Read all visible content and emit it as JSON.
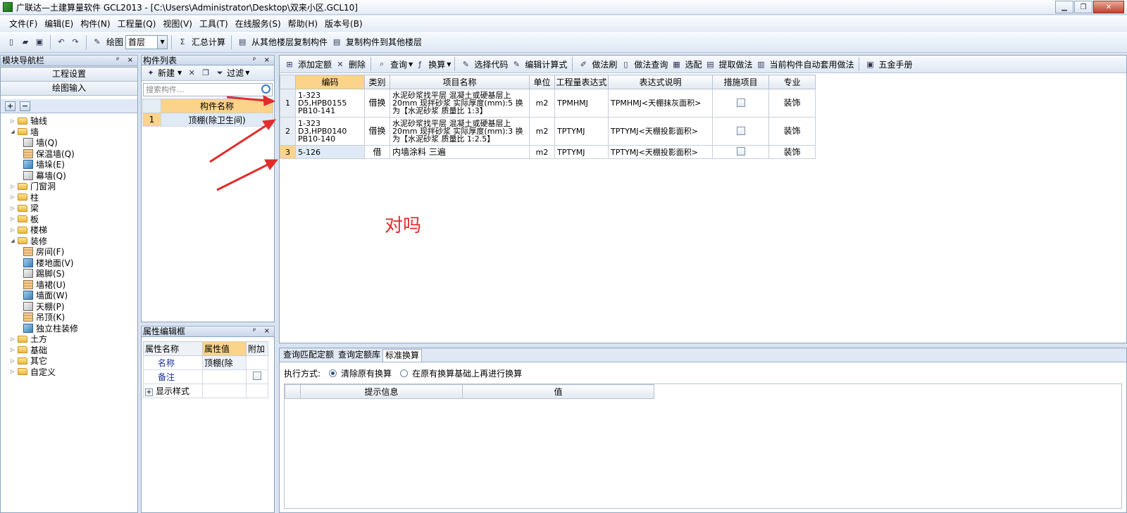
{
  "window": {
    "title": "广联达—土建算量软件 GCL2013 - [C:\\Users\\Administrator\\Desktop\\双来小区.GCL10]",
    "min": "▁",
    "max": "❐",
    "close": "✕"
  },
  "menu": [
    "文件(F)",
    "编辑(E)",
    "构件(N)",
    "工程量(Q)",
    "视图(V)",
    "工具(T)",
    "在线服务(S)",
    "帮助(H)",
    "版本号(B)"
  ],
  "toolbar": {
    "draw_label": "绘图",
    "floor_value": "首层",
    "summary_label": "汇总计算",
    "copy_from_label": "从其他楼层复制构件",
    "copy_to_label": "复制构件到其他楼层"
  },
  "nav": {
    "title": "模块导航栏",
    "pins": "ᵖ ×",
    "tab_project": "工程设置",
    "tab_draw": "绘图输入",
    "add": "+",
    "remove": "−",
    "tree": [
      {
        "label": "轴线",
        "level": 0,
        "expanded": false,
        "type": "folder"
      },
      {
        "label": "墙",
        "level": 0,
        "expanded": true,
        "type": "folder"
      },
      {
        "label": "墙(Q)",
        "level": 1,
        "type": "leaf"
      },
      {
        "label": "保温墙(Q)",
        "level": 1,
        "type": "leaf"
      },
      {
        "label": "墙垛(E)",
        "level": 1,
        "type": "leaf"
      },
      {
        "label": "幕墙(Q)",
        "level": 1,
        "type": "leaf"
      },
      {
        "label": "门窗洞",
        "level": 0,
        "expanded": false,
        "type": "folder"
      },
      {
        "label": "柱",
        "level": 0,
        "expanded": false,
        "type": "folder"
      },
      {
        "label": "梁",
        "level": 0,
        "expanded": false,
        "type": "folder"
      },
      {
        "label": "板",
        "level": 0,
        "expanded": false,
        "type": "folder"
      },
      {
        "label": "楼梯",
        "level": 0,
        "expanded": false,
        "type": "folder"
      },
      {
        "label": "装修",
        "level": 0,
        "expanded": true,
        "type": "folder"
      },
      {
        "label": "房间(F)",
        "level": 1,
        "type": "leaf"
      },
      {
        "label": "楼地面(V)",
        "level": 1,
        "type": "leaf"
      },
      {
        "label": "踢脚(S)",
        "level": 1,
        "type": "leaf"
      },
      {
        "label": "墙裙(U)",
        "level": 1,
        "type": "leaf"
      },
      {
        "label": "墙面(W)",
        "level": 1,
        "type": "leaf"
      },
      {
        "label": "天棚(P)",
        "level": 1,
        "type": "leaf"
      },
      {
        "label": "吊顶(K)",
        "level": 1,
        "type": "leaf"
      },
      {
        "label": "独立柱装修",
        "level": 1,
        "type": "leaf"
      },
      {
        "label": "土方",
        "level": 0,
        "expanded": false,
        "type": "folder"
      },
      {
        "label": "基础",
        "level": 0,
        "expanded": false,
        "type": "folder"
      },
      {
        "label": "其它",
        "level": 0,
        "expanded": false,
        "type": "folder"
      },
      {
        "label": "自定义",
        "level": 0,
        "expanded": false,
        "type": "folder"
      }
    ]
  },
  "components": {
    "title": "构件列表",
    "new_label": "新建",
    "filter_label": "过滤",
    "search_placeholder": "搜索构件...",
    "header": "构件名称",
    "rows": [
      {
        "num": "1",
        "name": "顶棚(除卫生间)"
      }
    ]
  },
  "props": {
    "title": "属性编辑框",
    "headers": [
      "属性名称",
      "属性值",
      "附加"
    ],
    "rows": [
      {
        "name": "名称",
        "value": "顶棚(除",
        "extra": false
      },
      {
        "name": "备注",
        "value": "",
        "extra": true
      },
      {
        "name": "显示样式",
        "value": "",
        "extra": false,
        "expander": "+"
      }
    ]
  },
  "main_toolbar": {
    "add_quota": "添加定额",
    "delete": "删除",
    "query": "查询",
    "convert": "换算",
    "select_code": "选择代码",
    "edit_formula": "编辑计算式",
    "method_brush": "做法刷",
    "method_query": "做法查询",
    "match": "选配",
    "extract": "提取做法",
    "auto_apply": "当前构件自动套用做法",
    "manual": "五金手册"
  },
  "quota_table": {
    "headers": [
      "编码",
      "类别",
      "项目名称",
      "单位",
      "工程量表达式",
      "表达式说明",
      "措施项目",
      "专业"
    ],
    "rows": [
      {
        "num": "1",
        "code": "1-323 D5,HPB0155 PB10-141",
        "category": "借换",
        "name": "水泥砂浆找平层 混凝土或硬基层上 20mm 现拌砂浆 实际厚度(mm):5 换为【水泥砂浆 质量比 1:3】",
        "unit": "m2",
        "expr": "TPMHMJ",
        "expr_desc": "TPMHMJ<天棚抹灰面积>",
        "measure": false,
        "specialty": "装饰"
      },
      {
        "num": "2",
        "code": "1-323 D3,HPB0140 PB10-140",
        "category": "借换",
        "name": "水泥砂浆找平层 混凝土或硬基层上 20mm 现拌砂浆 实际厚度(mm):3 换为【水泥砂浆 质量比 1:2.5】",
        "unit": "m2",
        "expr": "TPTYMJ",
        "expr_desc": "TPTYMJ<天棚投影面积>",
        "measure": false,
        "specialty": "装饰"
      },
      {
        "num": "3",
        "code": "5-126",
        "category": "借",
        "name": "内墙涂料 三遍",
        "unit": "m2",
        "expr": "TPTYMJ",
        "expr_desc": "TPTYMJ<天棚投影面积>",
        "measure": false,
        "specialty": "装饰"
      }
    ]
  },
  "annotation": "对吗",
  "bottom": {
    "tabs": [
      "查询匹配定额",
      "查询定额库",
      "标准换算"
    ],
    "exec_label": "执行方式:",
    "option1": "清除原有换算",
    "option2": "在原有换算基础上再进行换算",
    "headers": [
      "提示信息",
      "值"
    ]
  },
  "colors": {
    "accent_header": "#fbd38b",
    "annotation_red": "#e32b2b"
  }
}
